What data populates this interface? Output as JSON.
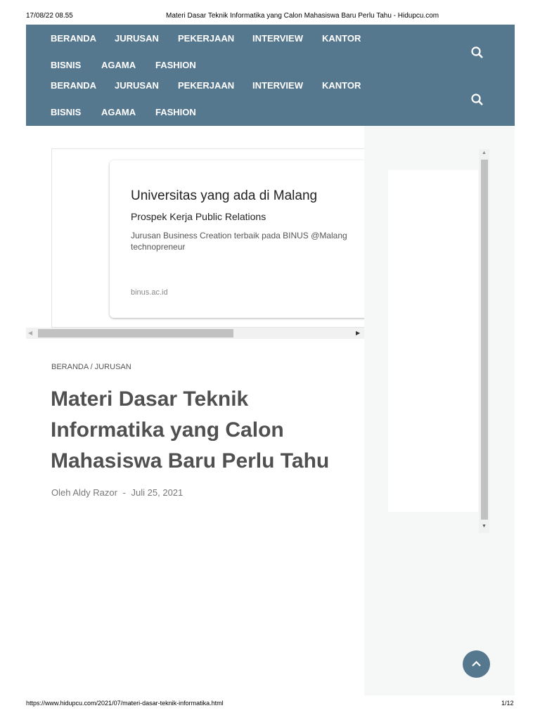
{
  "print_header": {
    "datetime": "17/08/22 08.55",
    "doc_title": "Materi Dasar Teknik Informatika yang Calon Mahasiswa Baru Perlu Tahu - Hidupcu.com"
  },
  "nav": {
    "row1": [
      "BERANDA",
      "JURUSAN",
      "PEKERJAAN",
      "INTERVIEW",
      "KANTOR"
    ],
    "row2": [
      "BISNIS",
      "AGAMA",
      "FASHION"
    ]
  },
  "ad": {
    "title": "Universitas yang ada di Malang",
    "subtitle": "Prospek Kerja Public Relations",
    "desc1": "Jurusan Business Creation terbaik pada BINUS @Malang",
    "desc2": "technopreneur",
    "domain": "binus.ac.id"
  },
  "article": {
    "breadcrumb": "BERANDA / JURUSAN",
    "title": "Materi Dasar Teknik Informatika yang Calon Mahasiswa Baru Perlu Tahu",
    "author": "Oleh Aldy Razor",
    "separator": "-",
    "date": "Juli 25, 2021"
  },
  "print_footer": {
    "url": "https://www.hidupcu.com/2021/07/materi-dasar-teknik-informatika.html",
    "page": "1/12"
  },
  "colors": {
    "nav_bg": "#56788f"
  }
}
